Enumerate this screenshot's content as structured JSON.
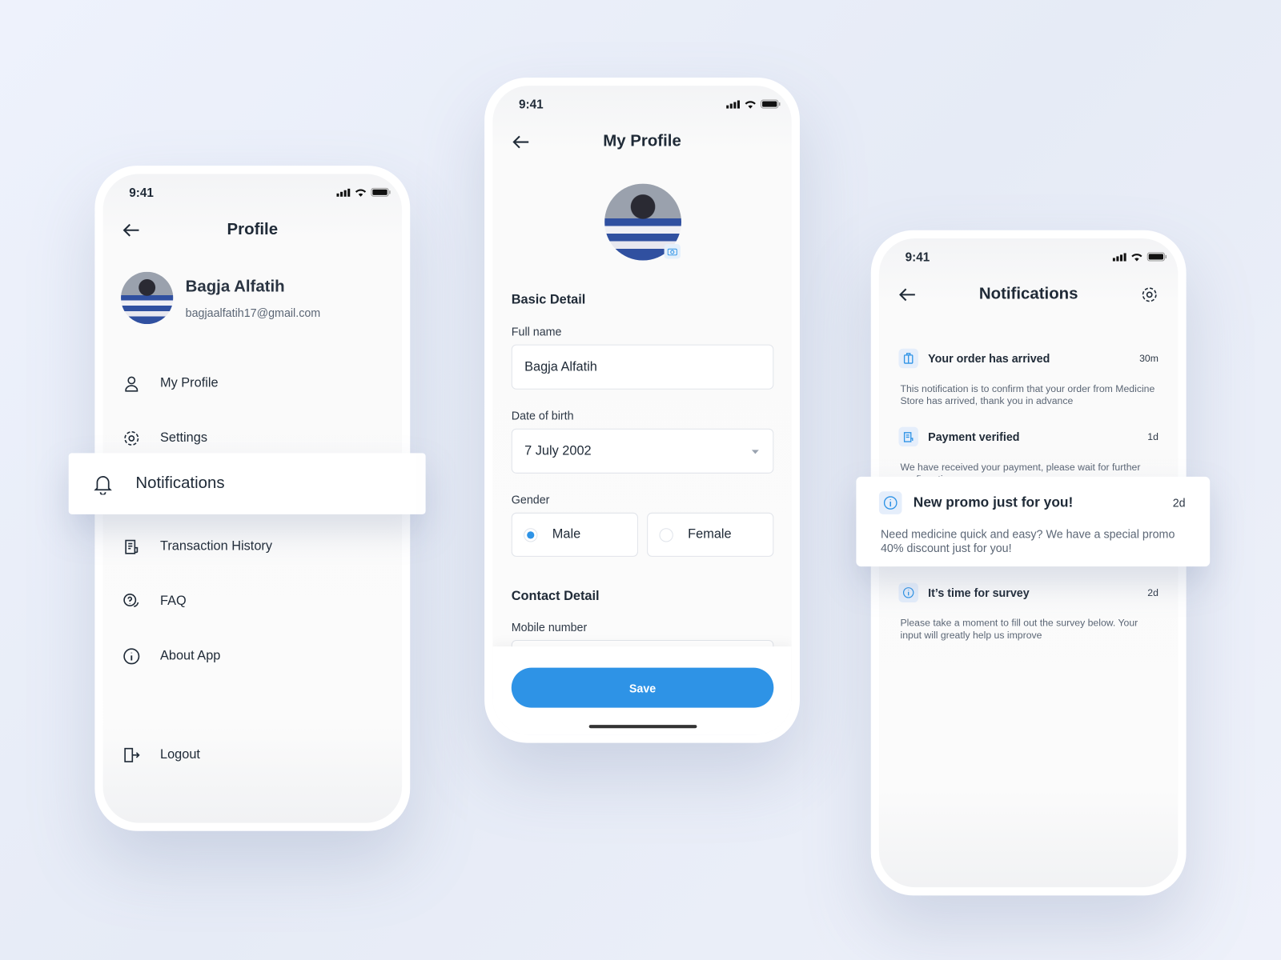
{
  "status_bar": {
    "time": "9:41"
  },
  "profile_screen": {
    "title": "Profile",
    "user": {
      "name": "Bagja Alfatih",
      "email": "bagjaalfatih17@gmail.com"
    },
    "menu": [
      {
        "label": "My Profile",
        "icon": "user-icon"
      },
      {
        "label": "Settings",
        "icon": "gear-icon"
      },
      {
        "label": "Notifications",
        "icon": "bell-icon",
        "highlighted": true
      },
      {
        "label": "Transaction History",
        "icon": "receipt-icon"
      },
      {
        "label": "FAQ",
        "icon": "help-chat-icon"
      },
      {
        "label": "About App",
        "icon": "info-icon"
      },
      {
        "label": "Logout",
        "icon": "logout-icon"
      }
    ]
  },
  "my_profile_screen": {
    "title": "My Profile",
    "basic_detail": "Basic Detail",
    "full_name_label": "Full name",
    "full_name_value": "Bagja Alfatih",
    "dob_label": "Date of birth",
    "dob_value": "7 July 2002",
    "gender_label": "Gender",
    "gender_options": [
      "Male",
      "Female"
    ],
    "gender_selected": "Male",
    "contact_detail": "Contact Detail",
    "mobile_label": "Mobile number",
    "save_label": "Save",
    "accent": "#2e93e6"
  },
  "notifications_screen": {
    "title": "Notifications",
    "items": [
      {
        "title": "Your order has arrived",
        "time": "30m",
        "body": "This notification is to confirm that your order from Medicine Store has arrived, thank you in advance",
        "icon": "package-icon"
      },
      {
        "title": "Payment verified",
        "time": "1d",
        "body": "We have received your payment, please wait for further confirmation",
        "icon": "receipt-icon"
      },
      {
        "title": "New promo just for you!",
        "time": "2d",
        "body": "Need medicine quick and easy? We have a special promo 40% discount just for you!",
        "icon": "info-icon",
        "highlighted": true
      },
      {
        "title": "It’s time for survey",
        "time": "2d",
        "body": "Please take a moment to fill out the survey below. Your input will greatly help us improve",
        "icon": "info-icon"
      }
    ]
  }
}
